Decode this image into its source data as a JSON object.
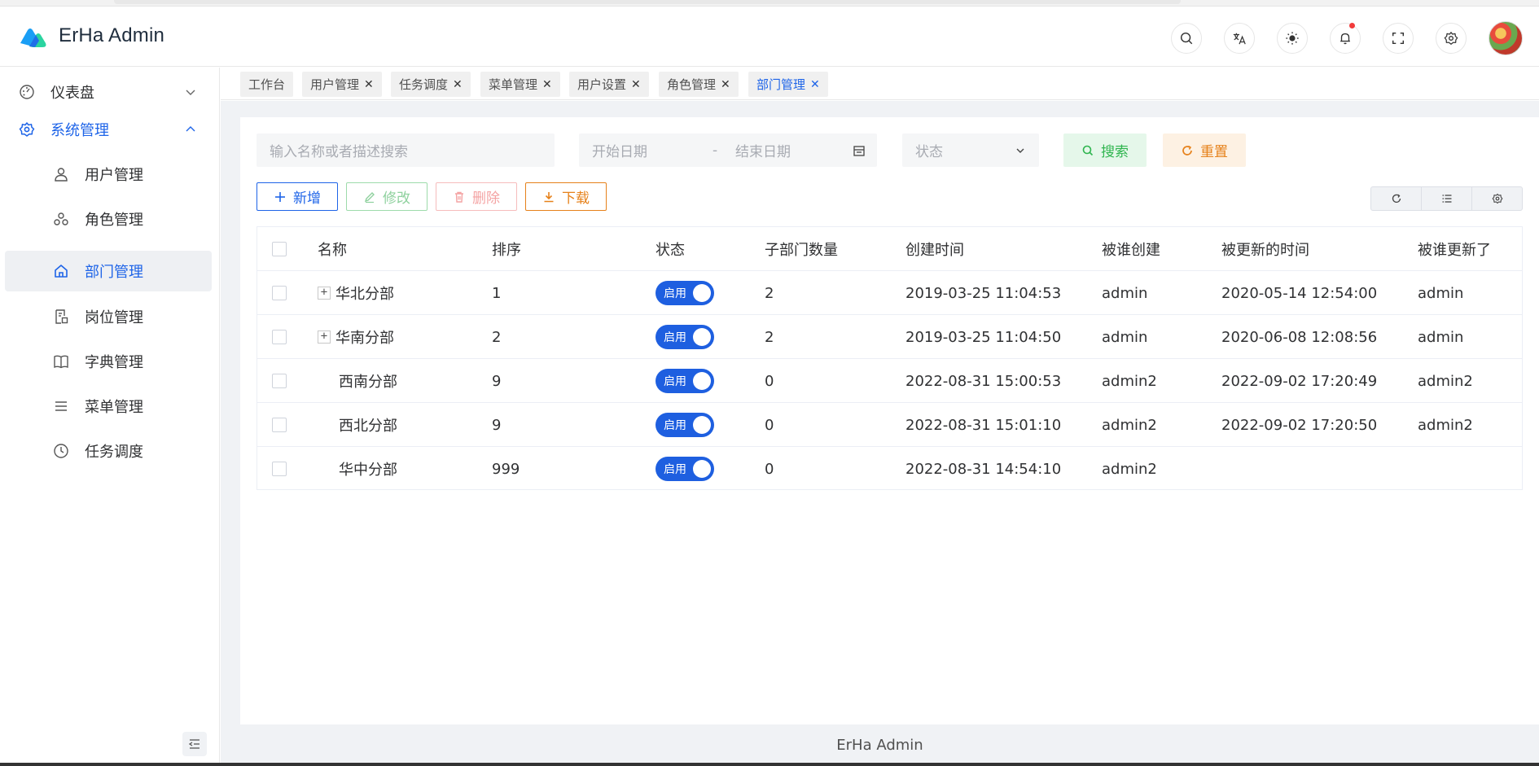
{
  "app": {
    "title": "ErHa Admin",
    "footer": "ErHa Admin"
  },
  "header_icons": [
    "search-icon",
    "translate-icon",
    "theme-icon",
    "bell-icon",
    "fullscreen-icon",
    "gear-icon"
  ],
  "sidebar": {
    "parents": [
      {
        "label": "仪表盘",
        "icon": "dashboard-icon",
        "expanded": false
      },
      {
        "label": "系统管理",
        "icon": "gear-icon",
        "expanded": true
      }
    ],
    "items": [
      {
        "label": "用户管理",
        "icon": "user-icon"
      },
      {
        "label": "角色管理",
        "icon": "roles-icon"
      },
      {
        "label": "部门管理",
        "icon": "home-icon",
        "active": true
      },
      {
        "label": "岗位管理",
        "icon": "post-icon"
      },
      {
        "label": "字典管理",
        "icon": "book-icon"
      },
      {
        "label": "菜单管理",
        "icon": "menu-icon"
      },
      {
        "label": "任务调度",
        "icon": "clock-icon"
      }
    ]
  },
  "tabs": [
    {
      "label": "工作台",
      "closable": false
    },
    {
      "label": "用户管理",
      "closable": true
    },
    {
      "label": "任务调度",
      "closable": true
    },
    {
      "label": "菜单管理",
      "closable": true
    },
    {
      "label": "用户设置",
      "closable": true
    },
    {
      "label": "角色管理",
      "closable": true
    },
    {
      "label": "部门管理",
      "closable": true,
      "active": true
    }
  ],
  "filters": {
    "search_placeholder": "输入名称或者描述搜索",
    "start_date_placeholder": "开始日期",
    "date_separator": "-",
    "end_date_placeholder": "结束日期",
    "status_placeholder": "状态",
    "search_label": "搜索",
    "reset_label": "重置"
  },
  "toolbar": {
    "add_label": "新增",
    "edit_label": "修改",
    "delete_label": "删除",
    "download_label": "下载"
  },
  "table": {
    "columns": [
      "名称",
      "排序",
      "状态",
      "子部门数量",
      "创建时间",
      "被谁创建",
      "被更新的时间",
      "被谁更新了"
    ],
    "rows": [
      {
        "name": "华北分部",
        "expandable": true,
        "sort": "1",
        "status": "启用",
        "children": "2",
        "created": "2019-03-25 11:04:53",
        "creator": "admin",
        "updated": "2020-05-14 12:54:00",
        "updater": "admin"
      },
      {
        "name": "华南分部",
        "expandable": true,
        "sort": "2",
        "status": "启用",
        "children": "2",
        "created": "2019-03-25 11:04:50",
        "creator": "admin",
        "updated": "2020-06-08 12:08:56",
        "updater": "admin"
      },
      {
        "name": "西南分部",
        "expandable": false,
        "sort": "9",
        "status": "启用",
        "children": "0",
        "created": "2022-08-31 15:00:53",
        "creator": "admin2",
        "updated": "2022-09-02 17:20:49",
        "updater": "admin2"
      },
      {
        "name": "西北分部",
        "expandable": false,
        "sort": "9",
        "status": "启用",
        "children": "0",
        "created": "2022-08-31 15:01:10",
        "creator": "admin2",
        "updated": "2022-09-02 17:20:50",
        "updater": "admin2"
      },
      {
        "name": "华中分部",
        "expandable": false,
        "sort": "999",
        "status": "启用",
        "children": "0",
        "created": "2022-08-31 14:54:10",
        "creator": "admin2",
        "updated": "",
        "updater": ""
      }
    ]
  },
  "colors": {
    "primary": "#1e64e8",
    "success": "#2fb54f",
    "danger": "#f56c6c",
    "warning": "#e6811a"
  }
}
